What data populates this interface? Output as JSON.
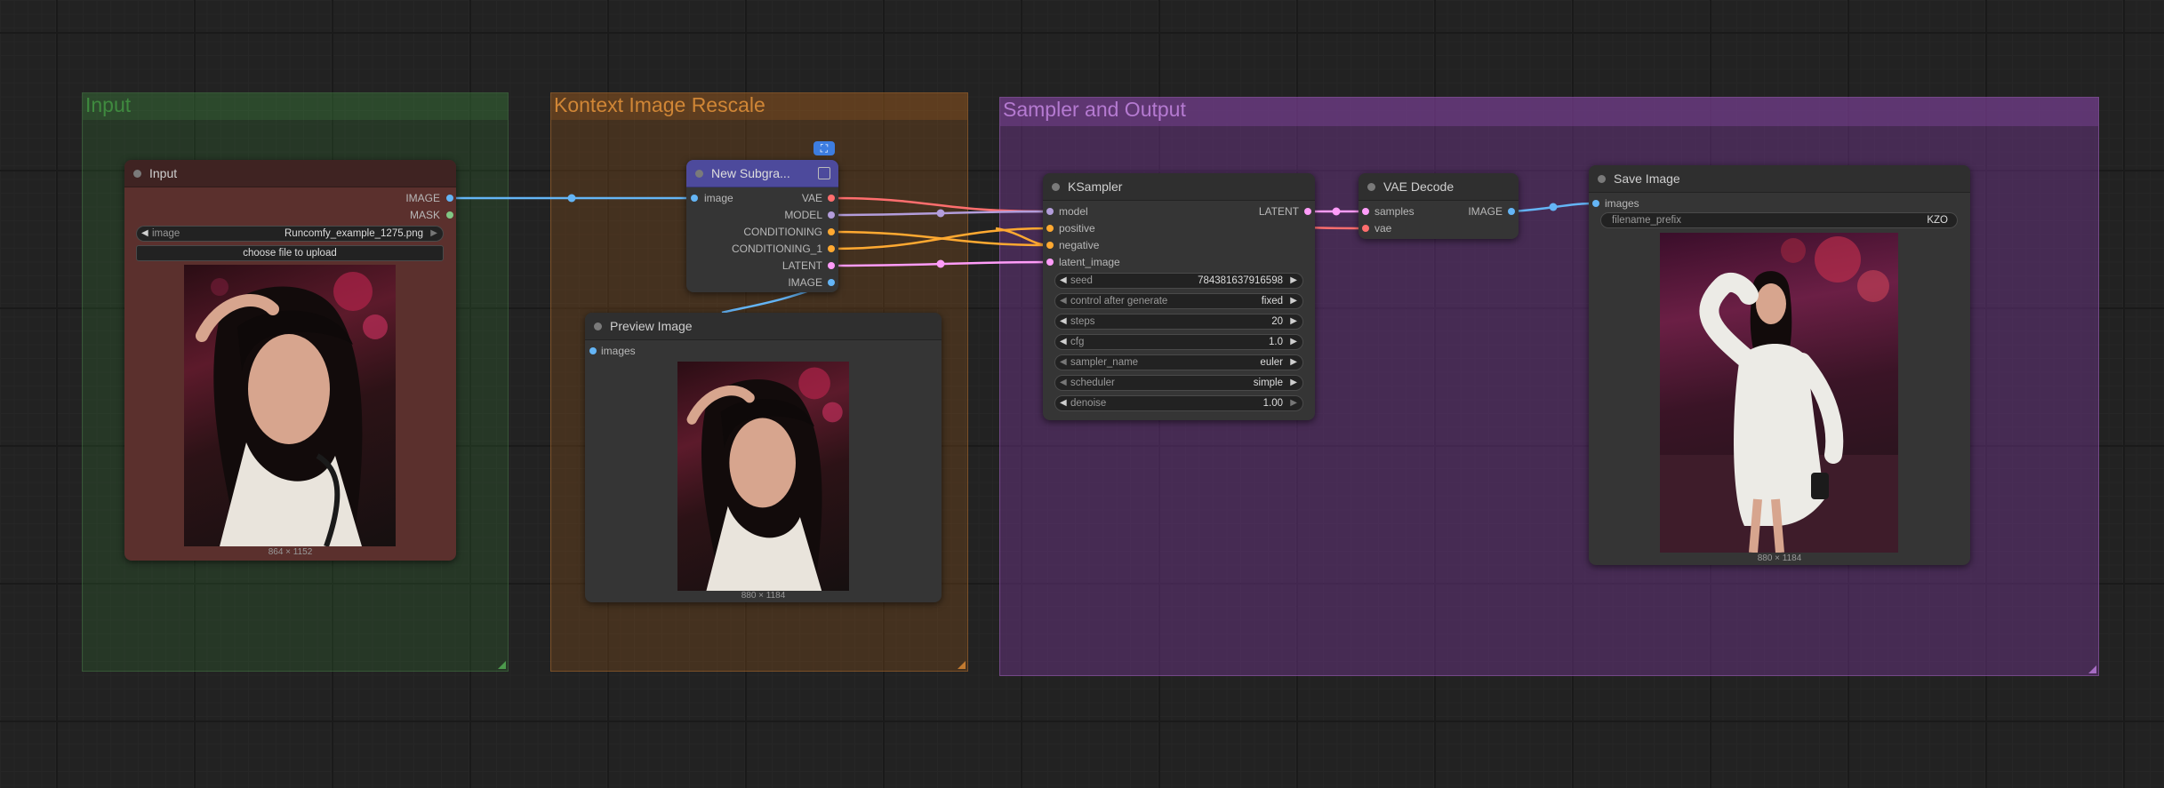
{
  "colors": {
    "group_input": "#2b4a2b",
    "group_kontext": "#4d3419",
    "group_sampler": "#4a2f57",
    "wire_image": "#64b5f6",
    "wire_vae": "#ff6e6e",
    "wire_model": "#b39ddb",
    "wire_conditioning": "#ffa931",
    "wire_latent": "#ff9cf9"
  },
  "groups": {
    "input": {
      "title": "Input"
    },
    "kontext": {
      "title": "Kontext Image Rescale"
    },
    "sampler": {
      "title": "Sampler and Output"
    }
  },
  "nodes": {
    "input": {
      "title": "Input",
      "outputs": [
        "IMAGE",
        "MASK"
      ],
      "image_widget": {
        "name": "image",
        "value": "Runcomfy_example_1275.png"
      },
      "upload_label": "choose file to upload",
      "caption": "864 × 1152"
    },
    "subgraph": {
      "title": "New Subgra...",
      "input": "image",
      "outputs": [
        "VAE",
        "MODEL",
        "CONDITIONING",
        "CONDITIONING_1",
        "LATENT",
        "IMAGE"
      ]
    },
    "preview": {
      "title": "Preview Image",
      "input": "images",
      "caption": "880 × 1184"
    },
    "ksampler": {
      "title": "KSampler",
      "inputs": [
        "model",
        "positive",
        "negative",
        "latent_image"
      ],
      "output": "LATENT",
      "widgets": [
        {
          "name": "seed",
          "value": "784381637916598"
        },
        {
          "name": "control after generate",
          "value": "fixed"
        },
        {
          "name": "steps",
          "value": "20"
        },
        {
          "name": "cfg",
          "value": "1.0"
        },
        {
          "name": "sampler_name",
          "value": "euler"
        },
        {
          "name": "scheduler",
          "value": "simple"
        },
        {
          "name": "denoise",
          "value": "1.00"
        }
      ]
    },
    "vae_decode": {
      "title": "VAE Decode",
      "inputs": [
        "samples",
        "vae"
      ],
      "output": "IMAGE"
    },
    "save": {
      "title": "Save Image",
      "input": "images",
      "prefix_widget": {
        "name": "filename_prefix",
        "value": "KZO"
      },
      "caption": "880 × 1184"
    }
  }
}
